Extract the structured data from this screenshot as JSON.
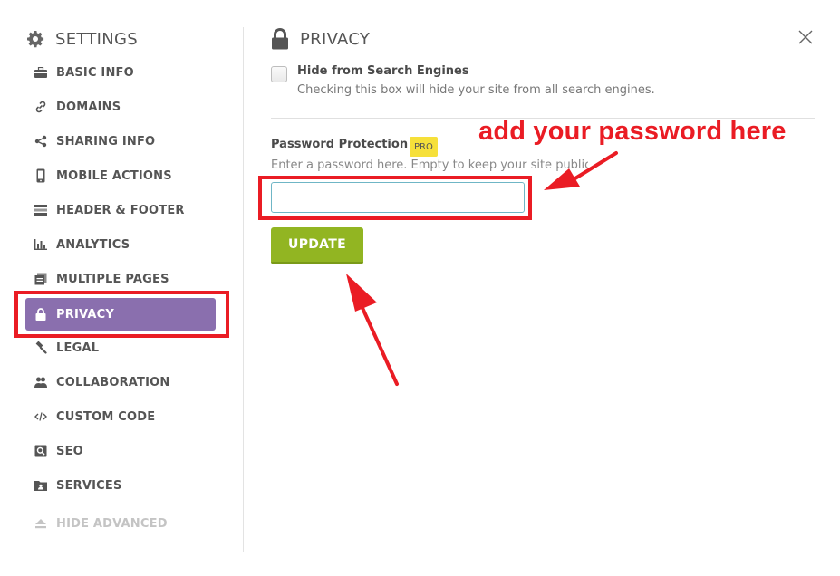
{
  "sidebar": {
    "title": "SETTINGS",
    "items": [
      {
        "label": "BASIC INFO",
        "icon": "briefcase-icon"
      },
      {
        "label": "DOMAINS",
        "icon": "link-icon"
      },
      {
        "label": "SHARING INFO",
        "icon": "share-icon"
      },
      {
        "label": "MOBILE ACTIONS",
        "icon": "mobile-icon"
      },
      {
        "label": "HEADER & FOOTER",
        "icon": "header-footer-icon"
      },
      {
        "label": "ANALYTICS",
        "icon": "bar-chart-icon"
      },
      {
        "label": "MULTIPLE PAGES",
        "icon": "pages-icon"
      },
      {
        "label": "PRIVACY",
        "icon": "lock-icon",
        "active": true
      },
      {
        "label": "LEGAL",
        "icon": "gavel-icon"
      },
      {
        "label": "COLLABORATION",
        "icon": "users-icon"
      },
      {
        "label": "CUSTOM CODE",
        "icon": "code-icon"
      },
      {
        "label": "SEO",
        "icon": "seo-icon"
      },
      {
        "label": "SERVICES",
        "icon": "services-icon"
      }
    ],
    "hide_advanced": "HIDE ADVANCED"
  },
  "main": {
    "title": "PRIVACY",
    "hide_search": {
      "label": "Hide from Search Engines",
      "help": "Checking this box will hide your site from all search engines.",
      "checked": false
    },
    "password": {
      "label": "Password Protection",
      "badge": "PRO",
      "help": "Enter a password here. Empty to keep your site public.",
      "value": "",
      "placeholder": ""
    },
    "update_label": "UPDATE"
  },
  "annotation": {
    "text": "add your password here",
    "color": "#ea1c24"
  },
  "colors": {
    "active_nav": "#8a6fae",
    "update_button": "#92b522",
    "pro_badge": "#f6e03a",
    "highlight": "#ea1c24"
  }
}
